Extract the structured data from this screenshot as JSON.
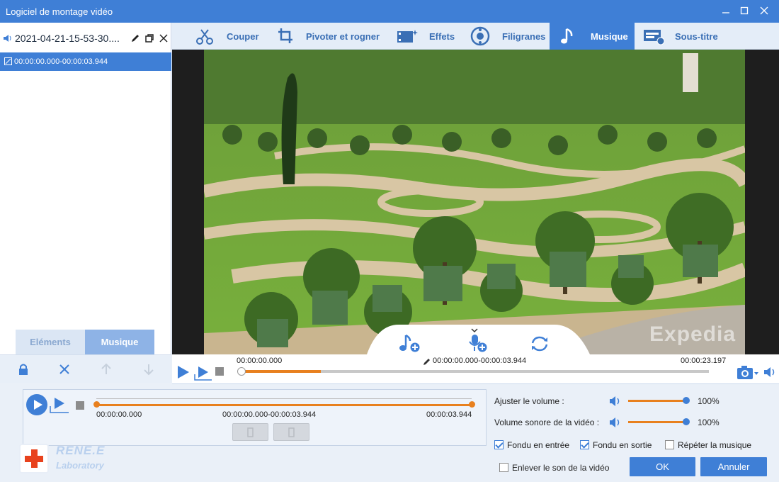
{
  "window": {
    "title": "Logiciel de montage vidéo"
  },
  "left_panel": {
    "file_name": "2021-04-21-15-53-30....",
    "clip_range": "00:00:00.000-00:00:03.944",
    "tabs": [
      "Eléments",
      "Musique"
    ],
    "active_tab": "Musique"
  },
  "toolbar": {
    "items": [
      {
        "label": "Couper",
        "icon": "cut-icon"
      },
      {
        "label": "Pivoter et rogner",
        "icon": "crop-rotate-icon"
      },
      {
        "label": "Effets",
        "icon": "effects-icon"
      },
      {
        "label": "Filigranes",
        "icon": "watermark-icon"
      },
      {
        "label": "Musique",
        "icon": "music-icon"
      },
      {
        "label": "Sous-titre",
        "icon": "subtitle-icon"
      }
    ],
    "active": "Musique"
  },
  "preview": {
    "watermark_text": "Expedia",
    "overlay_icons": [
      "add-music-icon",
      "add-voice-icon",
      "replace-icon"
    ]
  },
  "timeline": {
    "start_time": "00:00:00.000",
    "selection_range": "00:00:00.000-00:00:03.944",
    "end_time": "00:00:23.197",
    "progress_fraction": 0.17
  },
  "music_track": {
    "start_time": "00:00:00.000",
    "range": "00:00:00.000-00:00:03.944",
    "end_time": "00:00:03.944"
  },
  "volume": {
    "adjust_label": "Ajuster le volume :",
    "adjust_value": "100%",
    "video_label": "Volume sonore de la vidéo :",
    "video_value": "100%"
  },
  "options": {
    "fade_in": {
      "label": "Fondu en entrée",
      "checked": true
    },
    "fade_out": {
      "label": "Fondu en sortie",
      "checked": true
    },
    "repeat": {
      "label": "Répéter la musique",
      "checked": false
    },
    "remove_sound": {
      "label": "Enlever le son de la vidéo",
      "checked": false
    }
  },
  "buttons": {
    "ok": "OK",
    "cancel": "Annuler"
  },
  "logo": {
    "brand": "RENE.E",
    "sub": "Laboratory"
  },
  "colors": {
    "accent": "#3f7fd6",
    "orange": "#e8801e",
    "logo_red": "#e8421d"
  }
}
